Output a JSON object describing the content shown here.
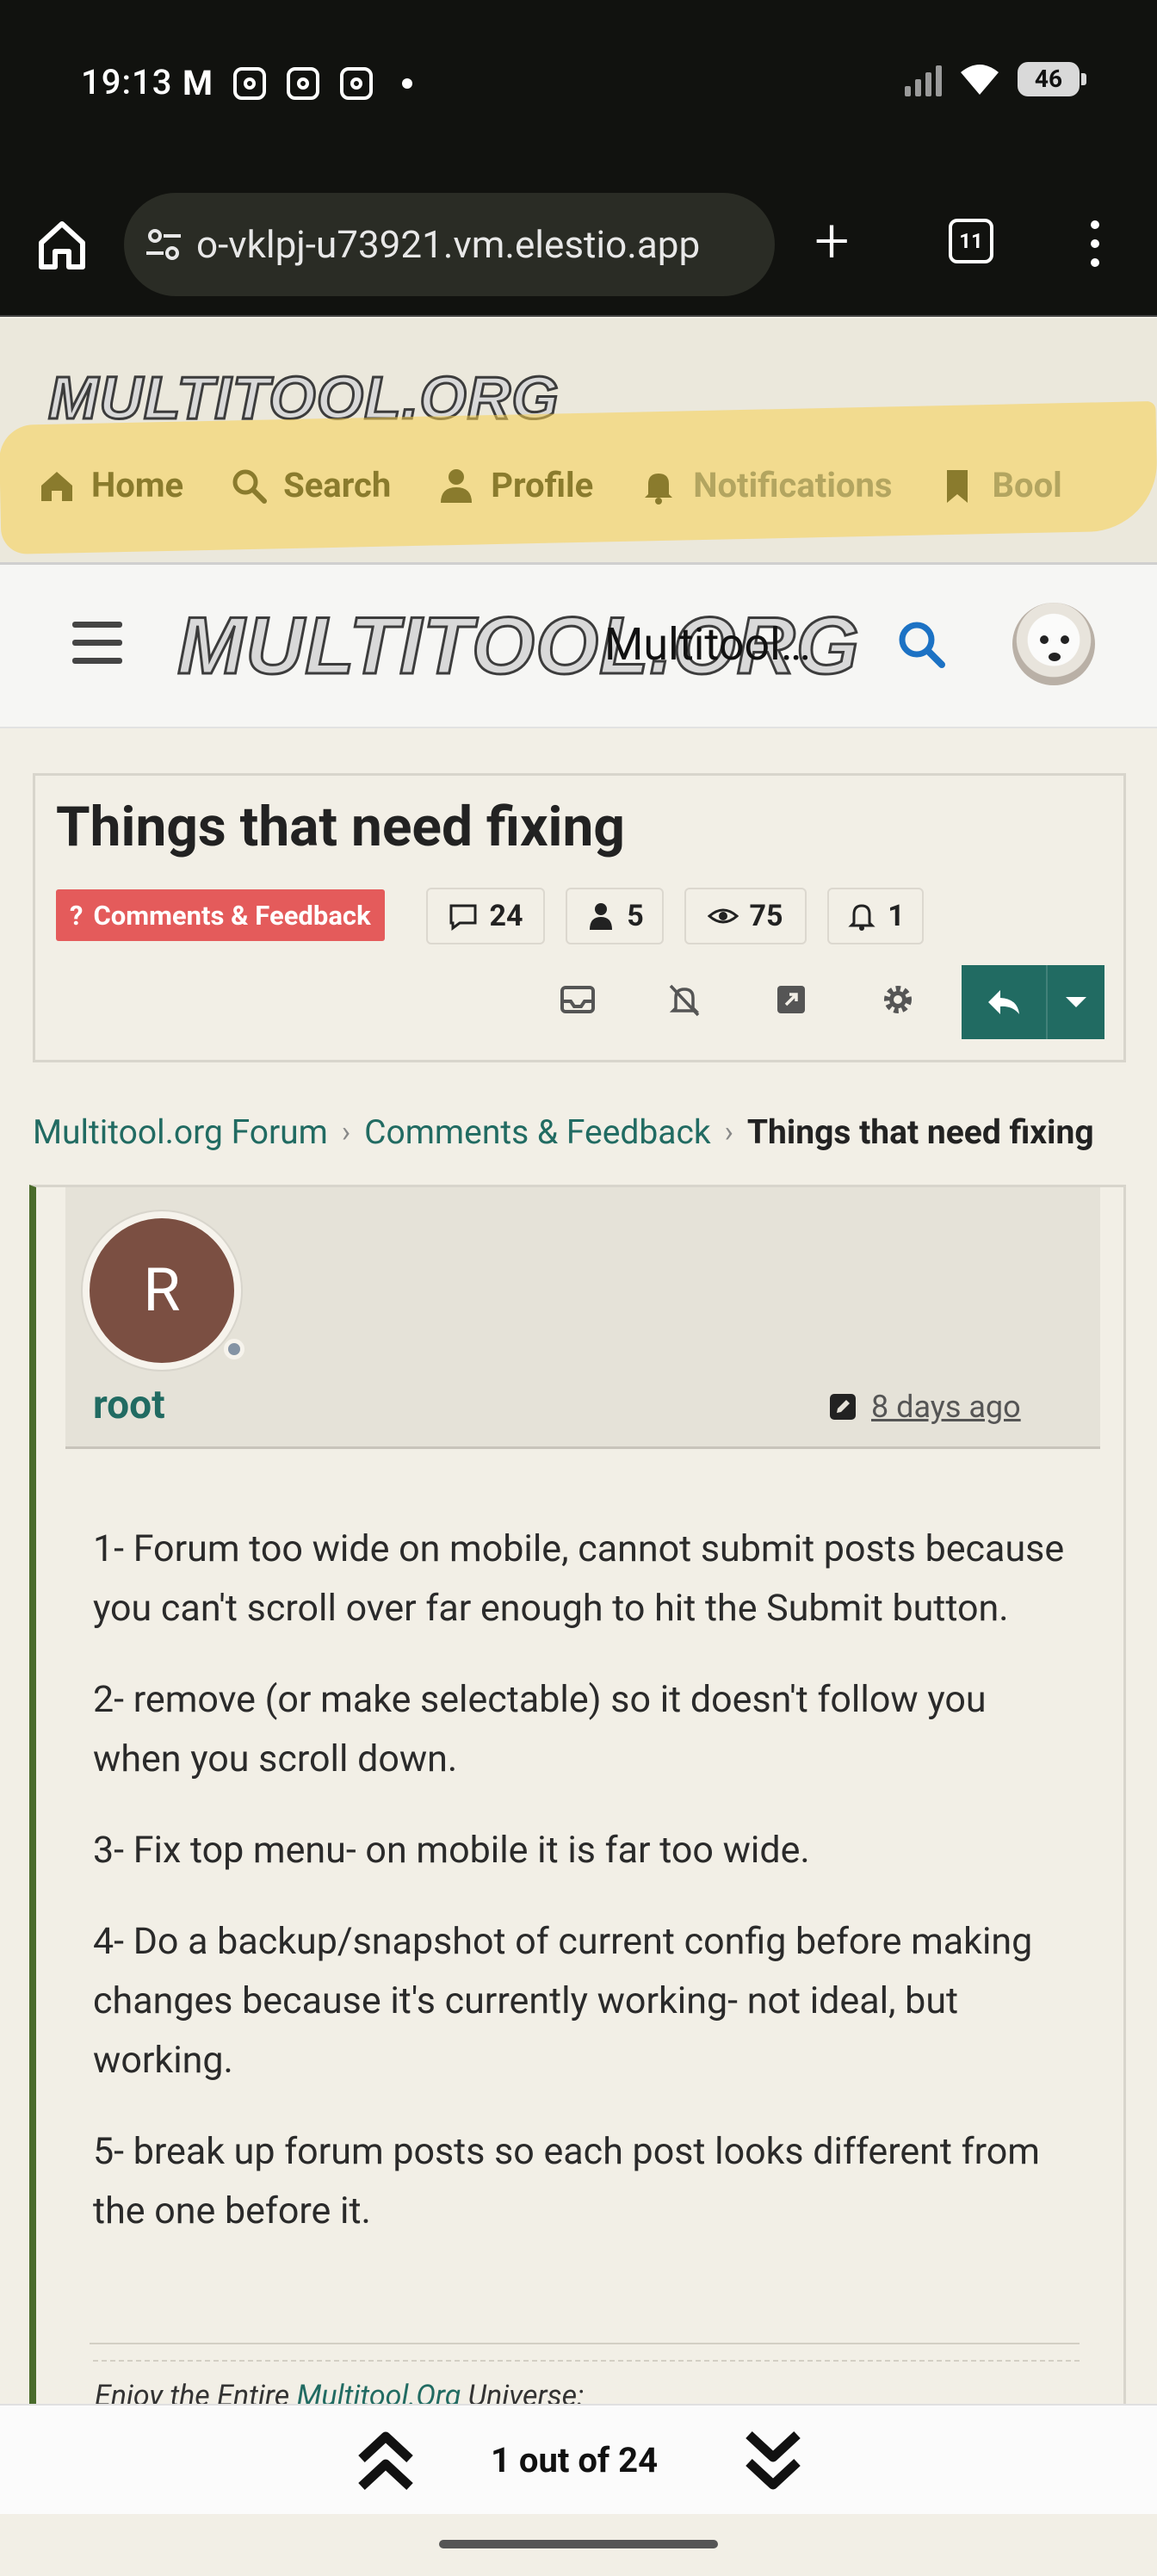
{
  "status_bar": {
    "time": "19:13",
    "battery": "46"
  },
  "browser": {
    "url": "o-vklpj-u73921.vm.elestio.app",
    "tab_count": "11"
  },
  "site_header": {
    "logo_text": "MULTITOOL.ORG",
    "nav": [
      {
        "label": "Home",
        "icon": "home-icon"
      },
      {
        "label": "Search",
        "icon": "search-icon"
      },
      {
        "label": "Profile",
        "icon": "person-icon"
      },
      {
        "label": "Notifications",
        "icon": "bell-icon"
      },
      {
        "label": "Bool",
        "icon": "bookmark-icon"
      }
    ]
  },
  "forum_header": {
    "logo_text": "MULTITOOL.ORG",
    "title": "Multitool…"
  },
  "topic": {
    "title": "Things that need fixing",
    "category": "Comments & Feedback",
    "replies": "24",
    "users": "5",
    "views": "75",
    "watchers": "1"
  },
  "breadcrumb": {
    "items": [
      "Multitool.org Forum",
      "Comments & Feedback"
    ],
    "current": "Things that need fixing"
  },
  "post": {
    "avatar_letter": "R",
    "username": "root",
    "date": "8 days ago",
    "paragraphs": [
      "1- Forum too wide on mobile, cannot submit posts because you can't scroll over far enough to hit the Submit button.",
      "2- remove (or make selectable) so it doesn't follow you when you scroll down.",
      "3- Fix top menu- on mobile it is far too wide.",
      "4- Do a backup/snapshot of current config before making changes because it's currently working- not ideal, but working.",
      "5- break up forum posts so each post looks different from the one before it."
    ],
    "signature_prefix": "Enjoy the Entire ",
    "signature_link": "Multitool.Org",
    "signature_suffix": " Universe:"
  },
  "navigator": {
    "label": "1 out of 24"
  },
  "colors": {
    "accent": "#216b62",
    "category": "#e45b5b",
    "highlight": "#f7cf50",
    "post_border": "#4a6b2b",
    "avatar": "#7b4f42"
  }
}
